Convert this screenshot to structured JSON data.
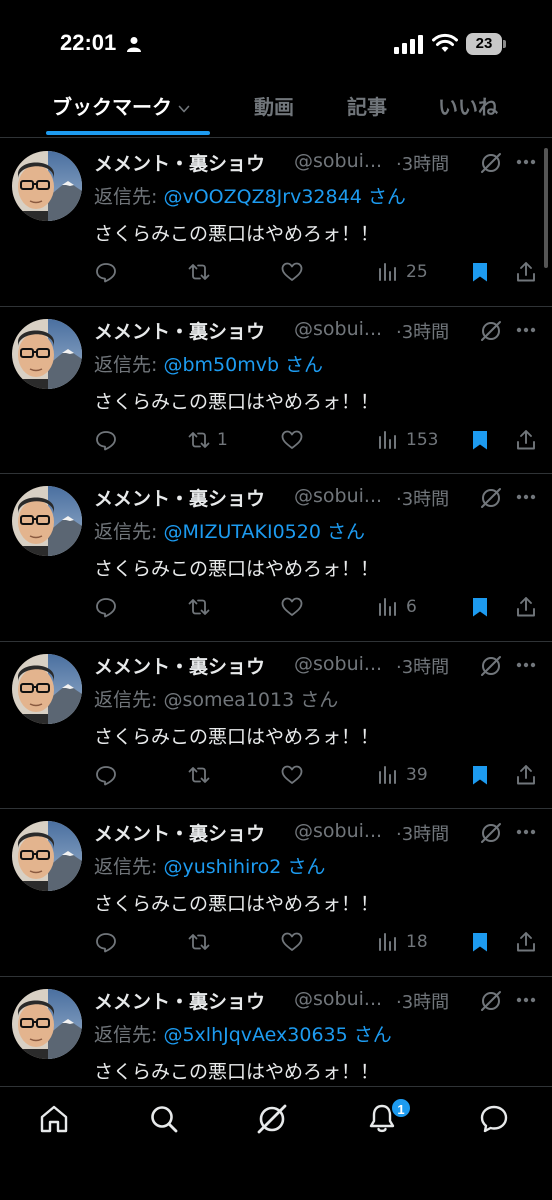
{
  "status_bar": {
    "time": "22:01",
    "battery": "23"
  },
  "tabs": [
    {
      "label": "ブックマーク",
      "active": true
    },
    {
      "label": "動画",
      "active": false
    },
    {
      "label": "記事",
      "active": false
    },
    {
      "label": "いいね",
      "active": false
    }
  ],
  "colors": {
    "accent": "#1d9bf0",
    "muted": "#71767b",
    "text": "#e7e9ea",
    "background": "#000000"
  },
  "tweets": [
    {
      "name": "メメント・裏ショウ",
      "handle": "@sobui...",
      "time": "·3時間",
      "reply_prefix": "返信先: ",
      "reply_to": "@vOOZQZ8Jrv32844",
      "reply_suffix": " さん",
      "text": "さくらみこの悪口はやめろォ！！",
      "replies": "",
      "retweets": "",
      "likes": "",
      "views": "25",
      "bookmarked": true
    },
    {
      "name": "メメント・裏ショウ",
      "handle": "@sobui...",
      "time": "·3時間",
      "reply_prefix": "返信先: ",
      "reply_to": "@bm50mvb",
      "reply_suffix": " さん",
      "text": "さくらみこの悪口はやめろォ！！",
      "replies": "",
      "retweets": "1",
      "likes": "",
      "views": "153",
      "bookmarked": true
    },
    {
      "name": "メメント・裏ショウ",
      "handle": "@sobui...",
      "time": "·3時間",
      "reply_prefix": "返信先: ",
      "reply_to": "@MIZUTAKI0520",
      "reply_suffix": " さん",
      "text": "さくらみこの悪口はやめろォ！！",
      "replies": "",
      "retweets": "",
      "likes": "",
      "views": "6",
      "bookmarked": true
    },
    {
      "name": "メメント・裏ショウ",
      "handle": "@sobui...",
      "time": "·3時間",
      "reply_prefix": "返信先: ",
      "reply_to": "@somea1013",
      "reply_suffix": " さん",
      "text": "さくらみこの悪口はやめろォ！！",
      "replies": "",
      "retweets": "",
      "likes": "",
      "views": "39",
      "bookmarked": true
    },
    {
      "name": "メメント・裏ショウ",
      "handle": "@sobui...",
      "time": "·3時間",
      "reply_prefix": "返信先: ",
      "reply_to": "@yushihiro2",
      "reply_suffix": " さん",
      "text": "さくらみこの悪口はやめろォ！！",
      "replies": "",
      "retweets": "",
      "likes": "",
      "views": "18",
      "bookmarked": true
    },
    {
      "name": "メメント・裏ショウ",
      "handle": "@sobui...",
      "time": "·3時間",
      "reply_prefix": "返信先: ",
      "reply_to": "@5xlhJqvAex30635",
      "reply_suffix": " さん",
      "text": "さくらみこの悪口はやめろォ！！",
      "replies": "",
      "retweets": "",
      "likes": "",
      "views": "",
      "bookmarked": true
    }
  ],
  "bottom_nav": {
    "items": [
      "home-icon",
      "search-icon",
      "grok-icon",
      "bell-icon",
      "messages-icon"
    ],
    "notification_badge": "1"
  }
}
